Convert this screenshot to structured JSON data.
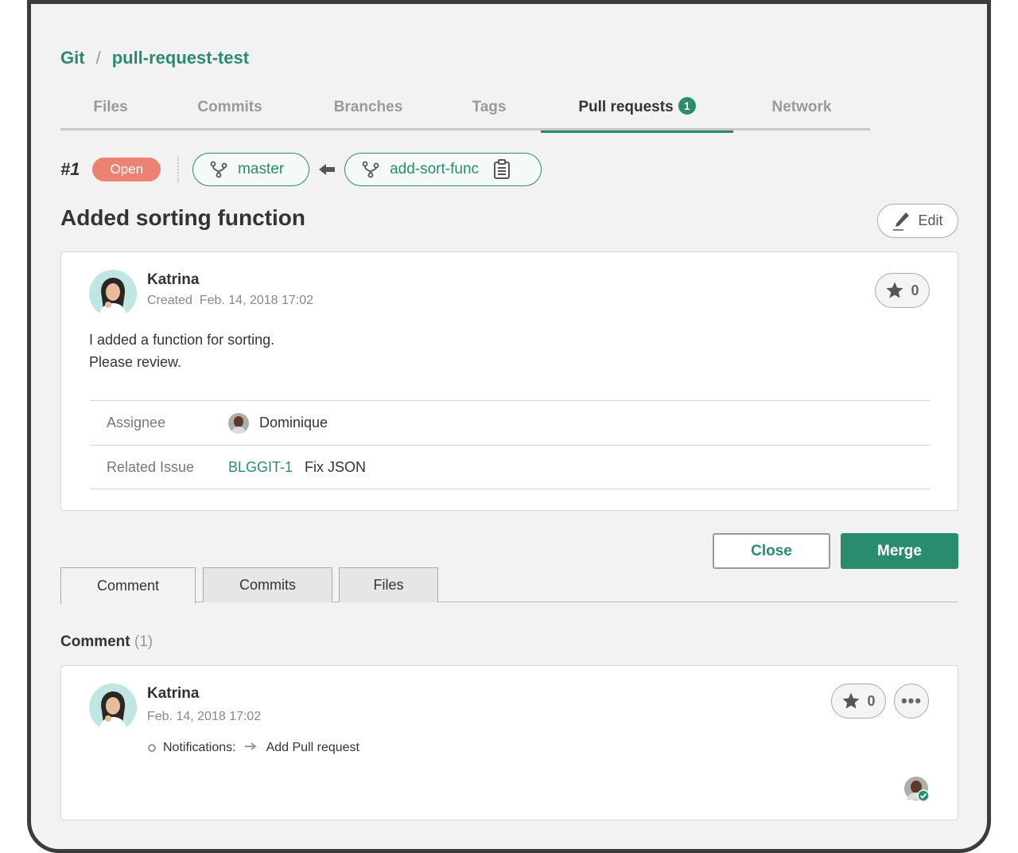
{
  "breadcrumb": {
    "project": "Git",
    "separator": "/",
    "repo": "pull-request-test"
  },
  "tabs": [
    {
      "label": "Files"
    },
    {
      "label": "Commits"
    },
    {
      "label": "Branches"
    },
    {
      "label": "Tags"
    },
    {
      "label": "Pull requests",
      "count": "1",
      "active": true
    },
    {
      "label": "Network"
    }
  ],
  "pull_request": {
    "number": "#1",
    "status": "Open",
    "base_branch": "master",
    "compare_branch": "add-sort-func",
    "title": "Added sorting function",
    "edit_label": "Edit",
    "author": "Katrina",
    "created_label": "Created",
    "created_date": "Feb. 14, 2018 17:02",
    "star_count": "0",
    "description": [
      "I added a function for sorting.",
      "Please review."
    ],
    "assignee_label": "Assignee",
    "assignee": "Dominique",
    "related_issue_label": "Related Issue",
    "related_issue_key": "BLGGIT-1",
    "related_issue_title": "Fix JSON"
  },
  "actions": {
    "close_label": "Close",
    "merge_label": "Merge"
  },
  "subtabs": [
    {
      "label": "Comment",
      "active": true
    },
    {
      "label": "Commits"
    },
    {
      "label": "Files"
    }
  ],
  "comments_section": {
    "heading": "Comment",
    "count": "(1)"
  },
  "comment": {
    "author": "Katrina",
    "date": "Feb. 14, 2018 17:02",
    "star_count": "0",
    "more_label": "•••",
    "notification_label": "Notifications:",
    "notification_target": "Add Pull request"
  },
  "colors": {
    "accent": "#2a8c6e",
    "status_open": "#ec8272",
    "background": "#f2f2f2"
  },
  "icons": [
    "branch-icon",
    "arrow-left-icon",
    "clipboard-icon",
    "pencil-icon",
    "star-icon",
    "more-icon",
    "check-icon"
  ]
}
